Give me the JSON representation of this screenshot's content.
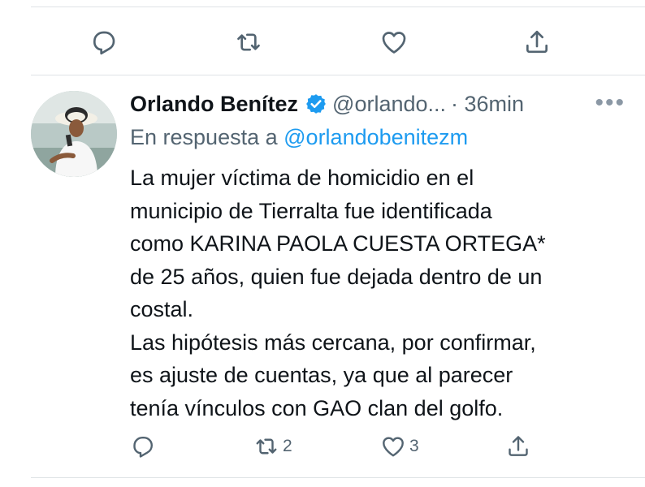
{
  "top_actions": {
    "reply_count": "",
    "retweet_count": "",
    "like_count": ""
  },
  "tweet": {
    "author_name": "Orlando Benítez",
    "handle": "@orlando...",
    "time": "· 36min",
    "more_label": "•••",
    "reply_prefix": "En respuesta a",
    "reply_mention": "@orlandobenitezm",
    "body_lines": [
      "La mujer víctima de homicidio en el",
      "municipio de Tierralta fue identificada",
      "como KARINA PAOLA CUESTA ORTEGA*",
      "de 25 años, quien fue dejada dentro de un",
      "costal.",
      "Las hipótesis más cercana, por confirmar,",
      "es ajuste de cuentas, ya que al parecer",
      "tenía vínculos con GAO clan del golfo."
    ],
    "actions": {
      "reply_count": "",
      "retweet_count": "2",
      "like_count": "3"
    }
  },
  "icons": {
    "reply": "reply-icon",
    "retweet": "retweet-icon",
    "like": "heart-icon",
    "share": "share-icon",
    "verified": "verified-badge-icon",
    "more": "more-icon"
  },
  "colors": {
    "text": "#0f1419",
    "secondary": "#536471",
    "accent": "#1d9bf0",
    "divider": "#dfe3e6"
  }
}
